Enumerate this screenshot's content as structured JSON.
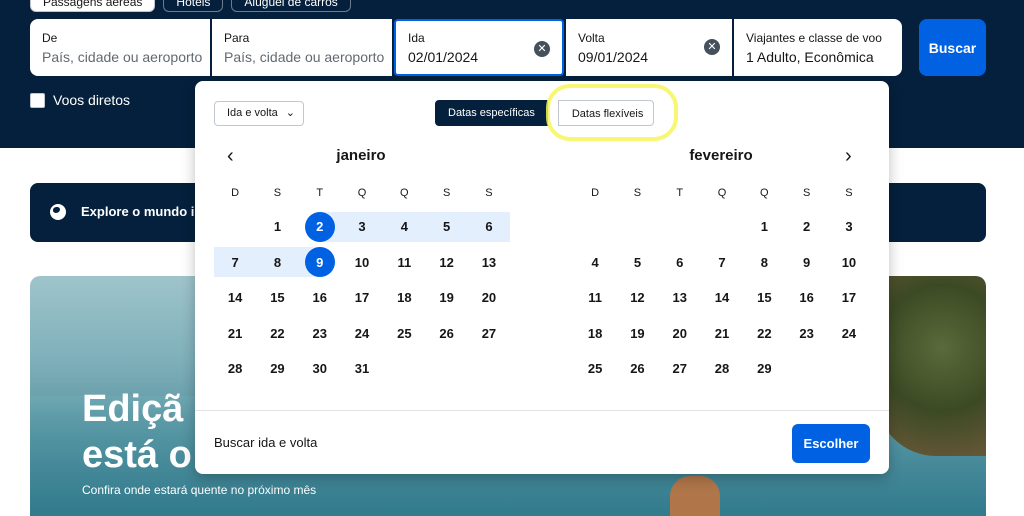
{
  "top_tabs": [
    "Passagens aéreas",
    "Hotéis",
    "Aluguel de carros"
  ],
  "search": {
    "from": {
      "label": "De",
      "placeholder": "País, cidade ou aeroporto"
    },
    "to": {
      "label": "Para",
      "placeholder": "País, cidade ou aeroporto"
    },
    "depart": {
      "label": "Ida",
      "value": "02/01/2024"
    },
    "return": {
      "label": "Volta",
      "value": "09/01/2024"
    },
    "travelers": {
      "label": "Viajantes e classe de voo",
      "value": "1 Adulto, Econômica"
    },
    "search_button": "Buscar",
    "direct_flights": "Voos diretos"
  },
  "banner": {
    "explore_text": "Explore o mundo in"
  },
  "hero": {
    "title_line1": "Ediçã",
    "title_line2": "está o",
    "subtitle": "Confira onde estará quente no próximo mês"
  },
  "picker": {
    "trip_type": "Ida e volta",
    "mode_specific": "Datas específicas",
    "mode_flexible": "Datas flexíveis",
    "month1": "janeiro",
    "month2": "fevereiro",
    "weekdays": [
      "D",
      "S",
      "T",
      "Q",
      "Q",
      "S",
      "S"
    ],
    "january_weeks": [
      [
        "",
        "1",
        "2",
        "3",
        "4",
        "5",
        "6"
      ],
      [
        "7",
        "8",
        "9",
        "10",
        "11",
        "12",
        "13"
      ],
      [
        "14",
        "15",
        "16",
        "17",
        "18",
        "19",
        "20"
      ],
      [
        "21",
        "22",
        "23",
        "24",
        "25",
        "26",
        "27"
      ],
      [
        "28",
        "29",
        "30",
        "31",
        "",
        "",
        ""
      ]
    ],
    "february_weeks": [
      [
        "",
        "",
        "",
        "",
        "1",
        "2",
        "3"
      ],
      [
        "4",
        "5",
        "6",
        "7",
        "8",
        "9",
        "10"
      ],
      [
        "11",
        "12",
        "13",
        "14",
        "15",
        "16",
        "17"
      ],
      [
        "18",
        "19",
        "20",
        "21",
        "22",
        "23",
        "24"
      ],
      [
        "25",
        "26",
        "27",
        "28",
        "29",
        "",
        ""
      ]
    ],
    "selected_start": "2",
    "selected_end": "9",
    "footer_text": "Buscar ida e volta",
    "choose_button": "Escolher"
  },
  "colors": {
    "navy": "#05203c",
    "accent": "#0062e3",
    "range": "#e3effd",
    "annotation": "#f6f65a"
  }
}
